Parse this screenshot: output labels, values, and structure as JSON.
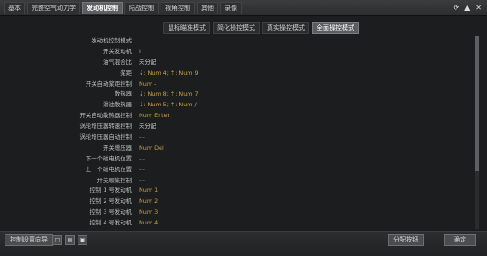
{
  "top_tabs": [
    {
      "label": "基本"
    },
    {
      "label": "完整空气动力学"
    },
    {
      "label": "发动机控制",
      "active": true
    },
    {
      "label": "陆战控制"
    },
    {
      "label": "视角控制"
    },
    {
      "label": "其他"
    },
    {
      "label": "录像"
    }
  ],
  "window_icons": {
    "refresh": "⟳",
    "pin": "▲",
    "close": "✕"
  },
  "control_modes": [
    {
      "label": "鼠标瞄准模式"
    },
    {
      "label": "简化操控模式"
    },
    {
      "label": "真实操控模式"
    },
    {
      "label": "全面操控模式",
      "active": true
    }
  ],
  "rows": [
    {
      "label": "发动机控制模式",
      "value": "-",
      "kind": "dash"
    },
    {
      "label": "开关发动机",
      "value": "I",
      "kind": "key"
    },
    {
      "label": "油气混合比",
      "value": "未分配",
      "kind": "txt"
    },
    {
      "label": "桨距",
      "value": "⇣: Num 4; ⇡: Num 9",
      "kind": "key"
    },
    {
      "label": "开关自动桨距控制",
      "value": "Num -",
      "kind": "key"
    },
    {
      "label": "散热器",
      "value": "⇣: Num 8; ⇡: Num 7",
      "kind": "key"
    },
    {
      "label": "滑油散热器",
      "value": "⇣: Num 5; ⇡: Num /",
      "kind": "key"
    },
    {
      "label": "开关自动散热器控制",
      "value": "Num Enter",
      "kind": "key"
    },
    {
      "label": "涡轮增压器转速控制",
      "value": "未分配",
      "kind": "txt"
    },
    {
      "label": "涡轮增压器自动控制",
      "value": "---",
      "kind": "dash"
    },
    {
      "label": "开关增压器",
      "value": "Num Del",
      "kind": "key"
    },
    {
      "label": "下一个磁电机位置",
      "value": "---",
      "kind": "dash"
    },
    {
      "label": "上一个磁电机位置",
      "value": "---",
      "kind": "dash"
    },
    {
      "label": "开关顺桨控制",
      "value": "---",
      "kind": "dash"
    },
    {
      "label": "控制 1 号发动机",
      "value": "Num 1",
      "kind": "key"
    },
    {
      "label": "控制 2 号发动机",
      "value": "Num 2",
      "kind": "key"
    },
    {
      "label": "控制 3 号发动机",
      "value": "Num 3",
      "kind": "key"
    },
    {
      "label": "控制 4 号发动机",
      "value": "Num 4",
      "kind": "key"
    }
  ],
  "bottom": {
    "wizard_label": "控制设置向导",
    "assign_label": "分配按钮",
    "ok_label": "确定",
    "icons": [
      "new-file-icon",
      "open-file-icon",
      "save-file-icon"
    ]
  },
  "colors": {
    "accent": "#c8a24a",
    "active_tab": "#5b5f62",
    "background": "#1b1d1e"
  }
}
